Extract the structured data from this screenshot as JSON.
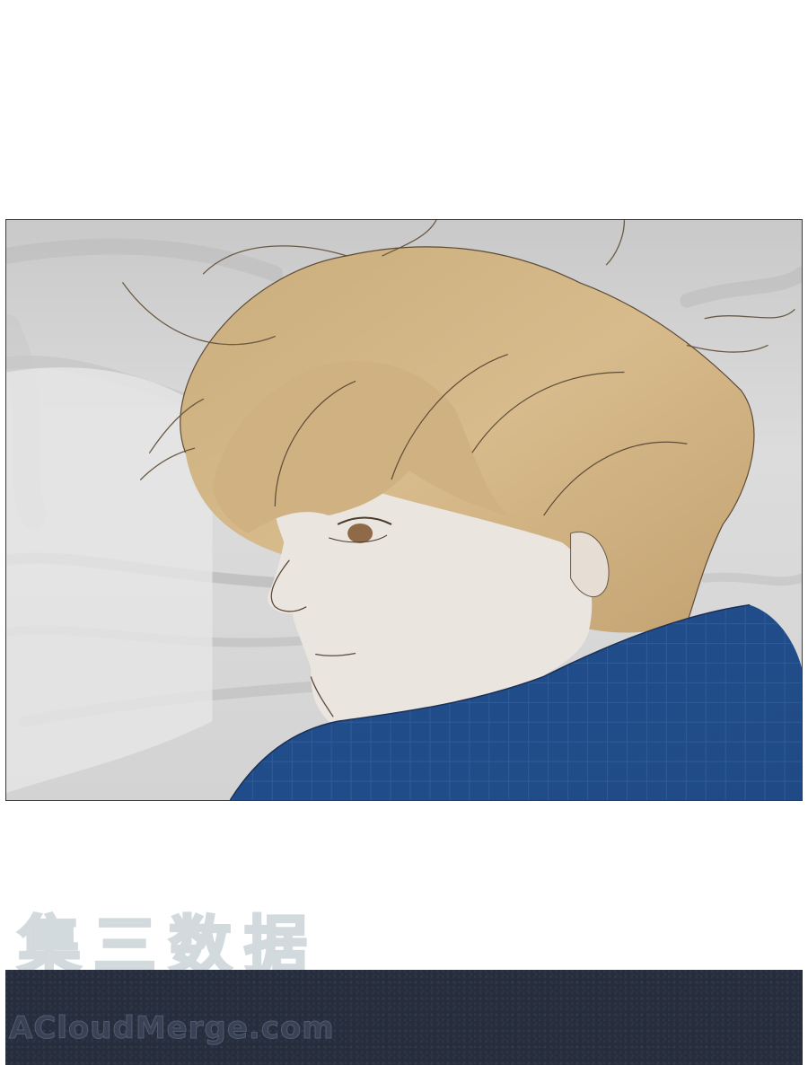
{
  "watermark": {
    "chinese": "集三数据",
    "url": "ACloudMerge.com"
  },
  "illustration": {
    "scene": "comic panel",
    "colors": {
      "sheet": "#d6d6d6",
      "hair": "#d2b487",
      "skin": "#ece6e1",
      "shirt": "#25518f",
      "outline": "#5a4a3a"
    }
  }
}
